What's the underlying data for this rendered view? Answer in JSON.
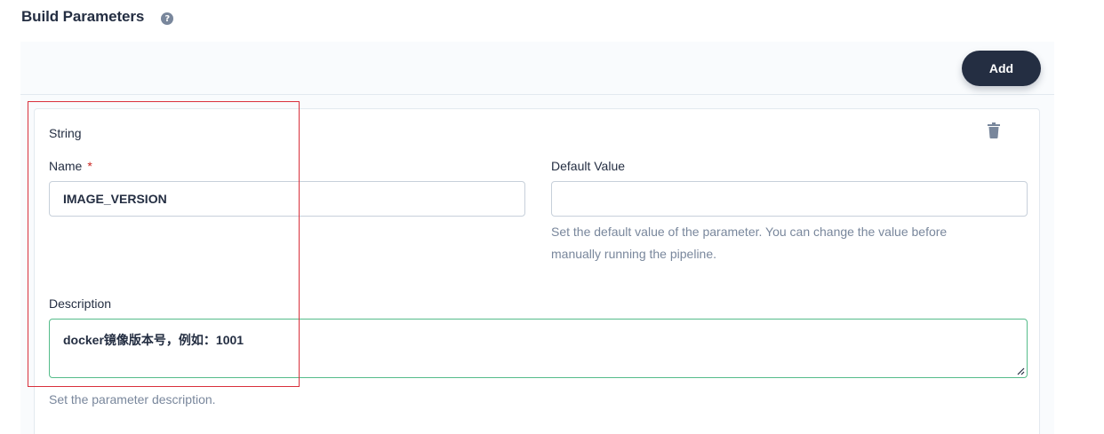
{
  "section": {
    "title": "Build Parameters",
    "help_icon": "question-circle-icon",
    "help_glyph": "?"
  },
  "toolbar": {
    "add_label": "Add"
  },
  "parameter": {
    "type_label": "String",
    "delete_icon": "trash-icon",
    "name": {
      "label": "Name",
      "required_mark": "*",
      "value": "IMAGE_VERSION"
    },
    "default_value": {
      "label": "Default Value",
      "value": "",
      "hint": "Set the default value of the parameter. You can change the value before manually running the pipeline."
    },
    "description": {
      "label": "Description",
      "value": "docker镜像版本号，例如：1001",
      "hint": "Set the parameter description."
    }
  },
  "colors": {
    "primary_dark": "#242e42",
    "muted_text": "#79879c",
    "required": "#ca2621",
    "focus_border": "#55bc8a",
    "highlight_box": "#d9303c"
  }
}
